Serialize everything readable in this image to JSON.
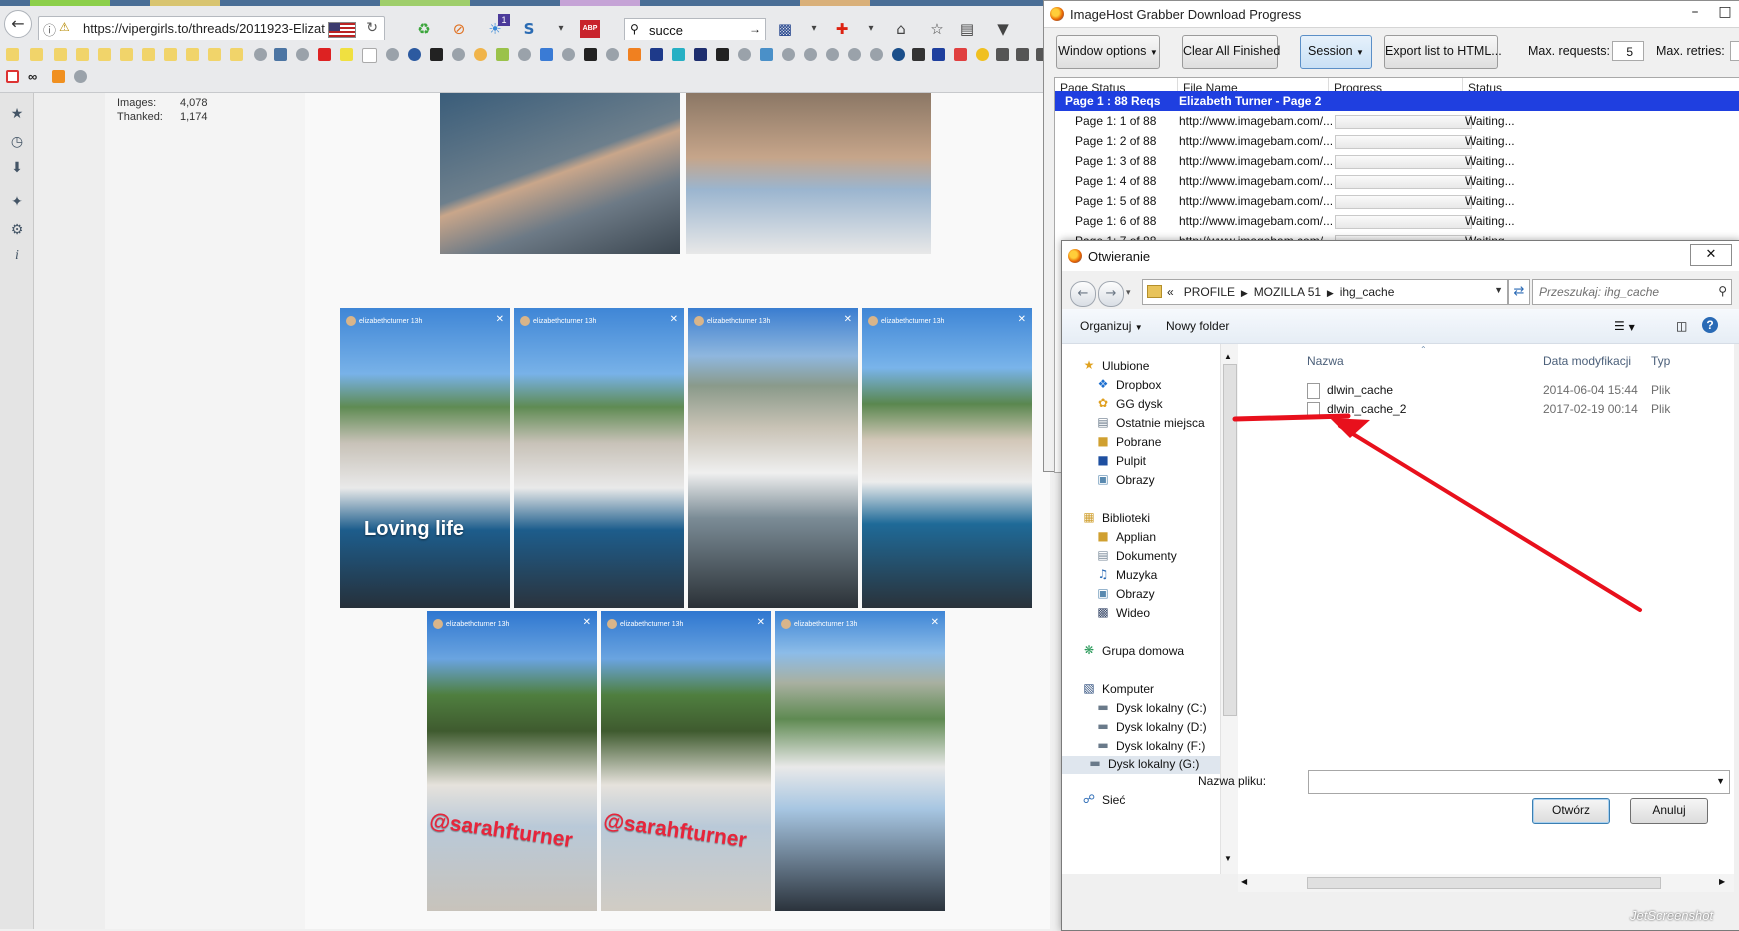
{
  "browser": {
    "url": "https://vipergirls.to/threads/2011923-Elizat",
    "search_query": "succe",
    "notification_count": "1",
    "abp_label": "ABP"
  },
  "page": {
    "user_stats": [
      {
        "label": "Images:",
        "value": "4,078"
      },
      {
        "label": "Thanked:",
        "value": "1,174"
      }
    ],
    "story_username": "elizabethcturner",
    "story_time": "13h",
    "overlay_loving": "Loving life",
    "overlay_sarah": "@sarahfturner"
  },
  "ihg": {
    "window_title": "ImageHost Grabber Download Progress",
    "buttons": {
      "window_options": "Window options",
      "clear_all": "Clear All Finished",
      "session": "Session",
      "export": "Export list to HTML..."
    },
    "max_requests_label": "Max. requests:",
    "max_requests_value": "5",
    "max_retries_label": "Max. retries:",
    "columns": [
      "Page Status",
      "File Name",
      "Progress",
      "Status"
    ],
    "group_row": {
      "page_status": "Page 1 : 88 Reqs",
      "file_name": "Elizabeth Turner - Page 2"
    },
    "rows": [
      {
        "page_status": "Page 1: 1 of 88",
        "file_name": "http://www.imagebam.com/...",
        "status": "Waiting..."
      },
      {
        "page_status": "Page 1: 2 of 88",
        "file_name": "http://www.imagebam.com/...",
        "status": "Waiting..."
      },
      {
        "page_status": "Page 1: 3 of 88",
        "file_name": "http://www.imagebam.com/...",
        "status": "Waiting..."
      },
      {
        "page_status": "Page 1: 4 of 88",
        "file_name": "http://www.imagebam.com/...",
        "status": "Waiting..."
      },
      {
        "page_status": "Page 1: 5 of 88",
        "file_name": "http://www.imagebam.com/...",
        "status": "Waiting..."
      },
      {
        "page_status": "Page 1: 6 of 88",
        "file_name": "http://www.imagebam.com/...",
        "status": "Waiting..."
      },
      {
        "page_status": "Page 1: 7 of 88",
        "file_name": "http://www.imagebam.com/...",
        "status": "Waiting..."
      }
    ]
  },
  "dialog": {
    "title": "Otwieranie",
    "breadcrumbs": [
      "«",
      "PROFILE",
      "MOZILLA 51",
      "ihg_cache"
    ],
    "search_placeholder": "Przeszukaj: ihg_cache",
    "toolbar": {
      "organize": "Organizuj",
      "new_folder": "Nowy folder"
    },
    "nav": {
      "favorites_header": "Ulubione",
      "favorites": [
        "Dropbox",
        "GG dysk",
        "Ostatnie miejsca",
        "Pobrane",
        "Pulpit",
        "Obrazy"
      ],
      "libraries_header": "Biblioteki",
      "libraries": [
        "Applian",
        "Dokumenty",
        "Muzyka",
        "Obrazy",
        "Wideo"
      ],
      "homegroup": "Grupa domowa",
      "computer_header": "Komputer",
      "drives": [
        "Dysk lokalny (C:)",
        "Dysk lokalny (D:)",
        "Dysk lokalny (F:)",
        "Dysk lokalny (G:)"
      ],
      "network": "Sieć"
    },
    "columns": {
      "name": "Nazwa",
      "date": "Data modyfikacji",
      "type": "Typ"
    },
    "files": [
      {
        "name": "dlwin_cache",
        "date": "2014-06-04 15:44",
        "type": "Plik"
      },
      {
        "name": "dlwin_cache_2",
        "date": "2017-02-19 00:14",
        "type": "Plik"
      }
    ],
    "filename_label": "Nazwa pliku:",
    "filename_value": "",
    "open_button": "Otwórz",
    "cancel_button": "Anuluj"
  },
  "watermark": "JetScreenshot",
  "colors": {
    "annotation_arrow": "#e8101c",
    "selection": "#1f3fe0"
  }
}
